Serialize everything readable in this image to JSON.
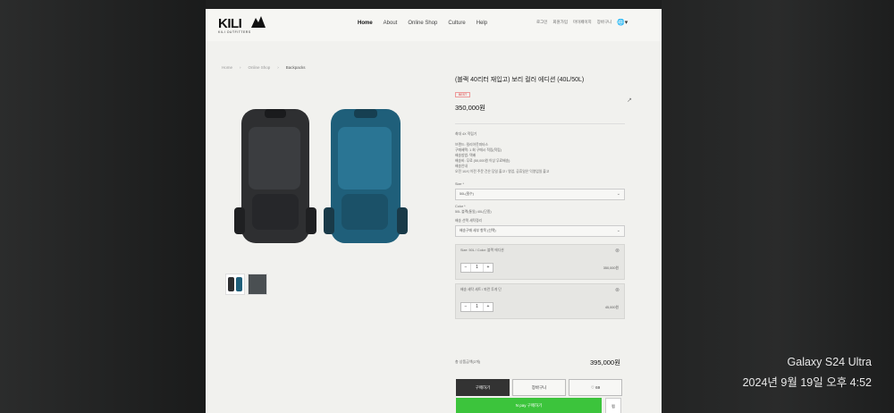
{
  "header": {
    "logo": "KILI",
    "logo_sub": "KILI OUTFITTERS",
    "nav": [
      "Home",
      "About",
      "Online Shop",
      "Culture",
      "Help"
    ],
    "active_nav": "Home",
    "util": [
      "로그인",
      "회원가입",
      "마이페이지",
      "장바구니"
    ],
    "globe": "🌐▾"
  },
  "breadcrumb": [
    "Home",
    "Online Shop",
    "Backpacks"
  ],
  "product": {
    "title": "(블랙 40리터 재입고) 보리 컬러 에디션 (40L/50L)",
    "badge": "BEST",
    "price": "350,000원",
    "share_icon": "↗",
    "notice": "최대 4X 적립기",
    "details": [
      "브랜드: 킬리아웃피터스",
      "구매혜택: 1 회 구매시 적립(적립)",
      "배송방법: 택배",
      "배송비: 무료 (50,000원 이상 무료배송)",
      "배송안내",
      "오전 10시 이전 주문 건은 당일 출고 / 영업, 공휴일은 익영업일 출고"
    ],
    "size_label": "Size *",
    "size_value": "50L(필수)",
    "color_label": "Color *",
    "color_value": "50L 블랙(통일) 40L(단종)",
    "addon_label": "배송 선택 세탁정리",
    "addon_value": "배송구매 세부 항목 (선택)",
    "options": [
      {
        "label": "Size: 50L / Color: 블랙 에디션",
        "qty": "1",
        "amount": "350,000원"
      },
      {
        "label": "배송 세탁 세트 / 파란 투게 단",
        "qty": "1",
        "amount": "45,000원"
      }
    ],
    "total_label": "총 상품금액(2개)",
    "total_value": "395,000원",
    "buttons": {
      "buy": "구매하기",
      "cart": "장바구니",
      "wish": "♡ 69"
    },
    "npay": "N pay 구매하기",
    "npay_side": "찜"
  },
  "watermark": {
    "device": "Galaxy S24 Ultra",
    "datetime": "2024년 9월 19일 오후 4:52"
  },
  "colors": {
    "accent_green": "#3cc43c",
    "buy_button": "#333333",
    "badge_red": "#dd3333"
  }
}
